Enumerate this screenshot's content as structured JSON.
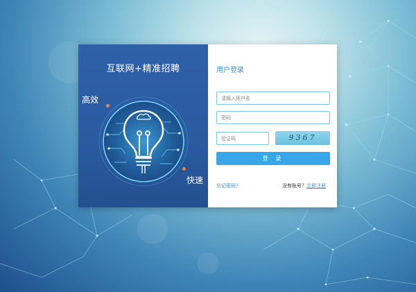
{
  "background": {
    "accent_color": "#3aa6ea",
    "network_color": "#8ad4f2"
  },
  "brand": {
    "title": "互联网+精准招聘",
    "tag_left": "高效",
    "tag_right": "快速",
    "illustration": "lightbulb-circuit-icon"
  },
  "login": {
    "title": "用户登录",
    "username_placeholder": "请输入用户名",
    "password_placeholder": "密码",
    "captcha_placeholder": "验证码",
    "captcha_code": "9367",
    "submit_label": "登 录",
    "forgot_label": "忘记密码？",
    "no_account_label": "没有账号？",
    "register_label": "立即注册"
  }
}
